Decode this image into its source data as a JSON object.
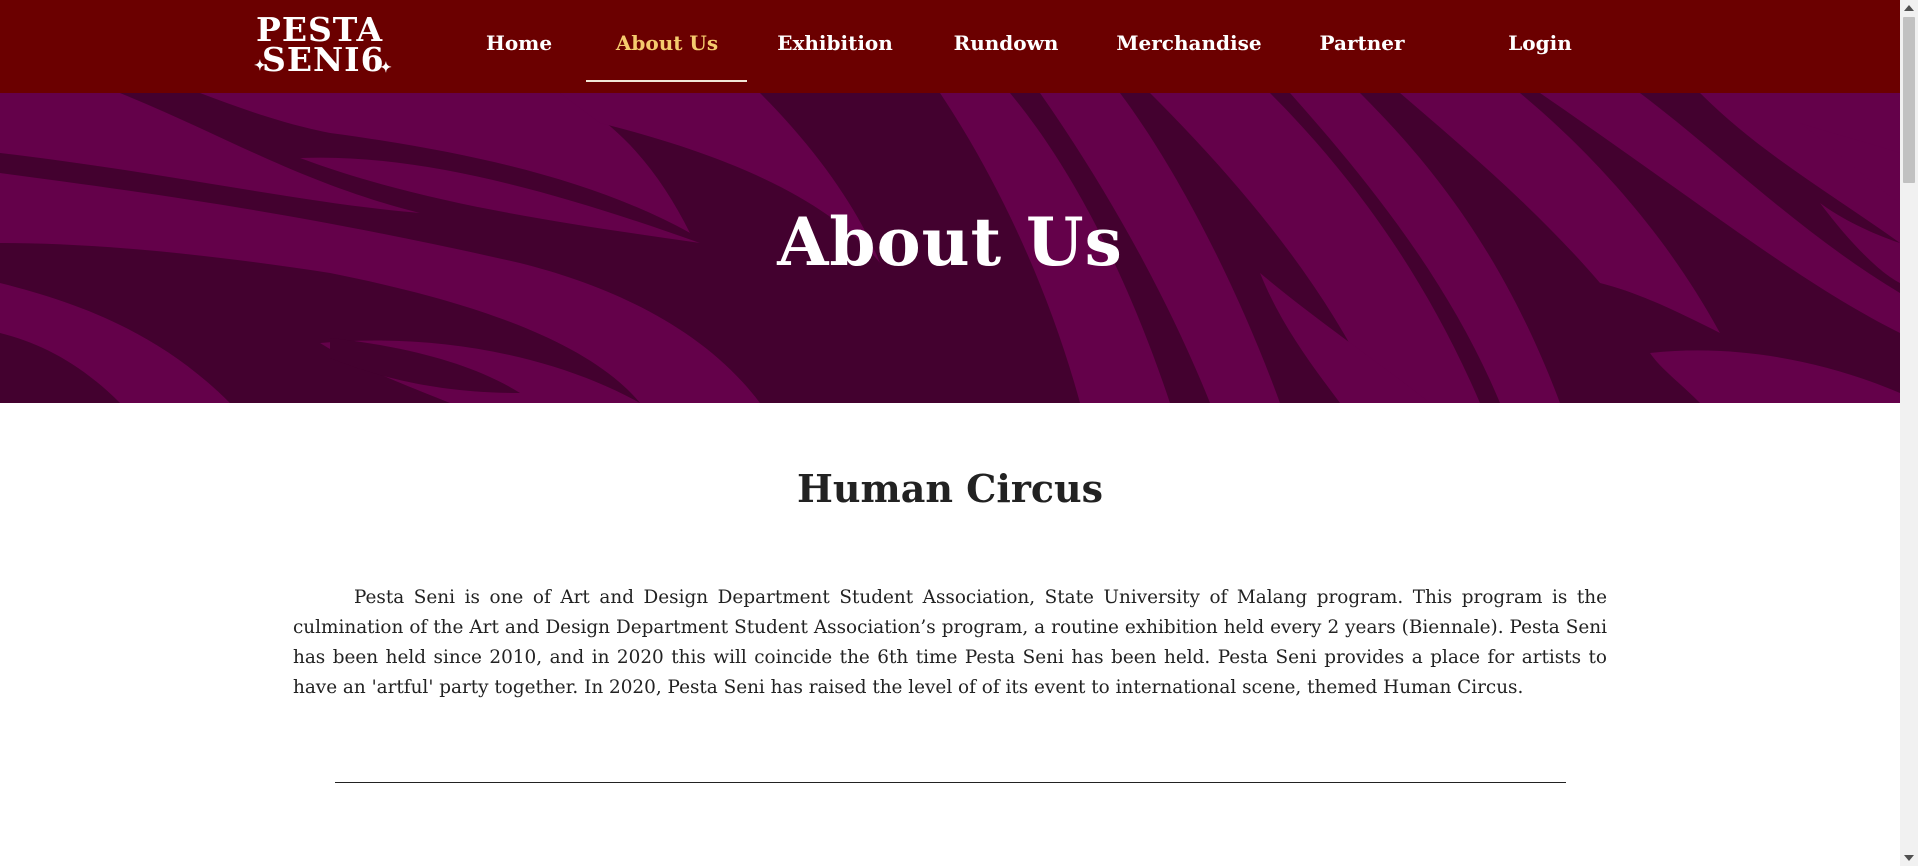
{
  "logo": {
    "line1": "PESTA",
    "line2": "SENI6"
  },
  "nav": {
    "items": [
      {
        "label": "Home"
      },
      {
        "label": "About Us",
        "active": true
      },
      {
        "label": "Exhibition"
      },
      {
        "label": "Rundown"
      },
      {
        "label": "Merchandise"
      },
      {
        "label": "Partner"
      },
      {
        "label": "Login"
      }
    ]
  },
  "hero": {
    "title": "About Us"
  },
  "content": {
    "title": "Human Circus",
    "paragraph": "Pesta Seni is one of Art and Design Department Student Association, State University of Malang program. This program is the culmination of the Art and Design Department Student Association’s program, a routine exhibition held every 2 years (Biennale). Pesta Seni has been held since 2010, and in 2020 this will coincide the 6th time Pesta Seni has been held. Pesta Seni provides a place for artists to have an 'artful' party together. In 2020, Pesta Seni has raised the level of of its event to international scene, themed Human Circus."
  },
  "colors": {
    "navbar": "#6b0000",
    "active_nav": "#f5cb6e",
    "hero_dark": "#43012f",
    "hero_light": "#64014a",
    "text": "#222222"
  }
}
